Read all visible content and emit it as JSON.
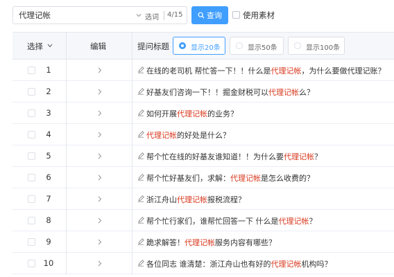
{
  "search": {
    "value": "代理记帐",
    "filter_label": "选词",
    "count": "4/15"
  },
  "query_button": {
    "label": "查询",
    "icon": "search-icon"
  },
  "use_material": {
    "label": "使用素材",
    "checked": false
  },
  "table": {
    "headers": {
      "select": "选择",
      "edit": "编辑",
      "title": "提问标题"
    },
    "display_options": [
      {
        "label": "显示20条",
        "selected": true
      },
      {
        "label": "显示50条",
        "selected": false
      },
      {
        "label": "显示100条",
        "selected": false
      }
    ],
    "rows": [
      {
        "num": "1",
        "parts": [
          "在线的老司机 帮忙答一下！！什么是",
          "代理记帐",
          "，为什么要做代理记账？"
        ]
      },
      {
        "num": "2",
        "parts": [
          "好基友们咨询一下！！掘金财税可以",
          "代理记帐",
          "么？"
        ]
      },
      {
        "num": "3",
        "parts": [
          "如何开展",
          "代理记帐",
          "的业务？"
        ]
      },
      {
        "num": "4",
        "parts": [
          "",
          "代理记帐",
          "的好处是什么？"
        ]
      },
      {
        "num": "5",
        "parts": [
          "帮个忙在线的好基友谁知道！！为什么要",
          "代理记帐",
          "？"
        ]
      },
      {
        "num": "6",
        "parts": [
          "帮个忙好基友们，求解：",
          "代理记帐",
          "是怎么收费的？"
        ]
      },
      {
        "num": "7",
        "parts": [
          "浙江舟山",
          "代理记帐",
          "报税流程？"
        ]
      },
      {
        "num": "8",
        "parts": [
          "帮个忙行家们，谁帮忙回答一下 什么是",
          "代理记帐",
          "？"
        ]
      },
      {
        "num": "9",
        "parts": [
          "跪求解答！",
          "代理记帐",
          "服务内容有哪些？"
        ]
      },
      {
        "num": "10",
        "parts": [
          "各位同志 谁清楚：浙江舟山也有好的",
          "代理记帐",
          "机构吗？"
        ]
      }
    ]
  },
  "colors": {
    "accent": "#409eff",
    "highlight": "#d9381e"
  }
}
